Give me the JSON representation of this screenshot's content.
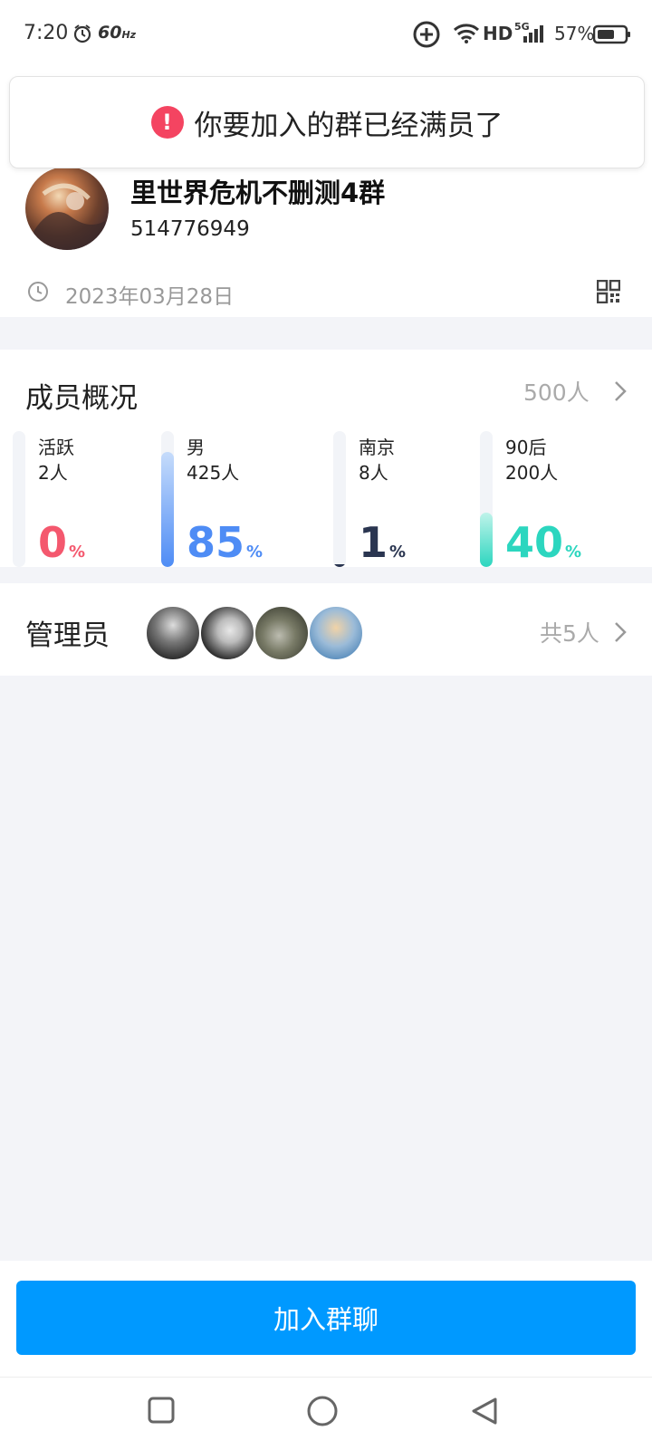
{
  "status_bar": {
    "time": "7:20",
    "refresh_rate": "60",
    "refresh_unit": "Hz",
    "network_hd": "HD",
    "network_gen": "5G",
    "battery_percent": "57%"
  },
  "toast": {
    "icon_text": "!",
    "message": "你要加入的群已经满员了"
  },
  "group": {
    "name": "里世界危机不删测4群",
    "id": "514776949",
    "created_date": "2023年03月28日"
  },
  "members": {
    "title": "成员概况",
    "total": "500人",
    "stats": [
      {
        "label": "活跃",
        "count": "2人",
        "percent": "0",
        "percent_sign": "%",
        "fraction": 0.0,
        "color": "#f4586e"
      },
      {
        "label": "男",
        "count": "425人",
        "percent": "85",
        "percent_sign": "%",
        "fraction": 0.85,
        "color": "#4e8cf5"
      },
      {
        "label": "南京",
        "count": "8人",
        "percent": "1",
        "percent_sign": "%",
        "fraction": 0.01,
        "color": "#2a3550"
      },
      {
        "label": "90后",
        "count": "200人",
        "percent": "40",
        "percent_sign": "%",
        "fraction": 0.4,
        "color": "#2cd6bf"
      }
    ]
  },
  "admins": {
    "title": "管理员",
    "total": "共5人"
  },
  "actions": {
    "join_label": "加入群聊"
  },
  "colors": {
    "accent": "#0099ff",
    "toast_icon": "#f44461",
    "background": "#f3f4f8"
  }
}
